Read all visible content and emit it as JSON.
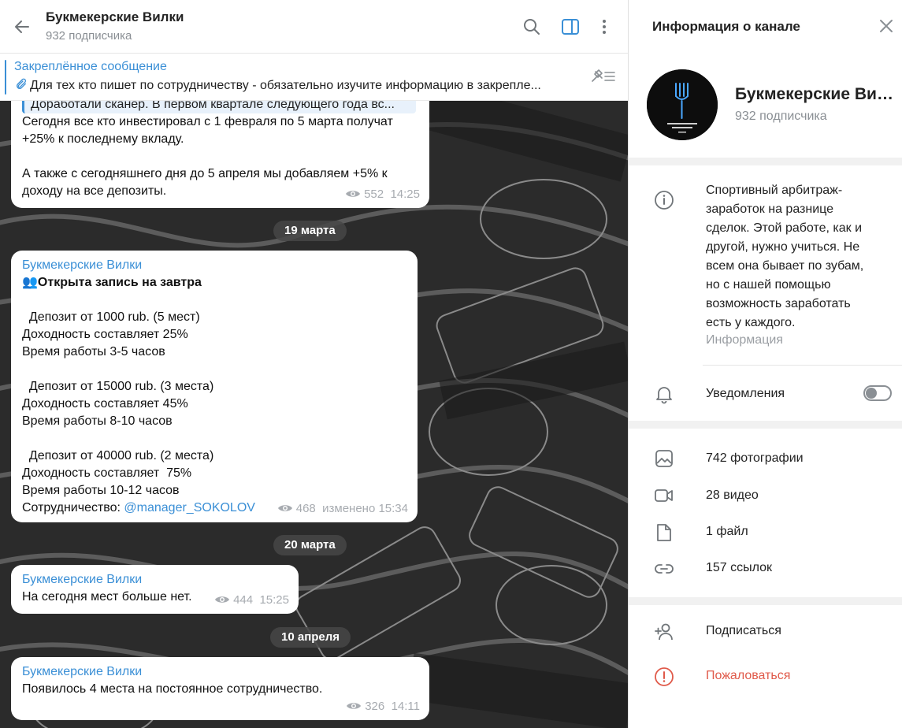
{
  "chat": {
    "title": "Букмекерские Вилки",
    "subtitle": "932 подписчика",
    "pinned": {
      "label": "Закреплённое сообщение",
      "text": "Для тех кто пишет по сотрудничеству - обязательно изучите информацию в закрепле..."
    },
    "messages": [
      {
        "quote": "Доработали сканер. В первом квартале следующего года вс...",
        "lines": [
          "Сегодня все кто инвестировал с 1 февраля по 5 марта получат",
          "+25% к последнему вкладу.",
          "",
          "А также с сегодняшнего дня до 5 апреля мы добавляем +5% к",
          "доходу на все депозиты."
        ],
        "views": "552",
        "time": "14:25"
      },
      {
        "author": "Букмекерские Вилки",
        "headline_emoji": "👥",
        "headline": "Открыта запись на завтра",
        "lines": [
          "",
          "  Депозит от 1000 rub. (5 мест)",
          "Доходность составляет 25%",
          "Время работы 3-5 часов",
          "",
          "  Депозит от 15000 rub. (3 места)",
          "Доходность составляет 45%",
          "Время работы 8-10 часов",
          "",
          "  Депозит от 40000 rub. (2 места)",
          "Доходность составляет  75%",
          "Время работы 10-12 часов"
        ],
        "last_prefix": "Сотрудничество: ",
        "last_link": "@manager_SOKOLOV",
        "views": "468",
        "time": "изменено 15:34"
      },
      {
        "author": "Букмекерские Вилки",
        "text": "На сегодня мест больше нет.",
        "views": "444",
        "time": "15:25"
      },
      {
        "author": "Букмекерские Вилки",
        "text": "Появилось 4 места на постоянное сотрудничество.",
        "views": "326",
        "time": "14:11"
      }
    ],
    "dates": [
      "19 марта",
      "20 марта",
      "10 апреля"
    ]
  },
  "info": {
    "title": "Информация о канале",
    "name": "Букмекерские Вил...",
    "subscribers": "932 подписчика",
    "avatar_caption": "БУКМЕКЕРСКИЕ ВИЛКИ",
    "description": "Спортивный арбитраж- заработок на разнице сделок. Этой работе, как и другой, нужно учиться. Не всем она бывает по зубам, но с нашей помощью возможность заработать есть у каждого.",
    "description_caption": "Информация",
    "notifications_label": "Уведомления",
    "notifications_on": false,
    "media": {
      "photos": "742 фотографии",
      "videos": "28 видео",
      "files": "1 файл",
      "links": "157 ссылок"
    },
    "subscribe_label": "Подписаться",
    "report_label": "Пожаловаться",
    "colors": {
      "accent": "#3a8fd6",
      "danger": "#e05a4a",
      "muted": "#8a8f94"
    }
  }
}
